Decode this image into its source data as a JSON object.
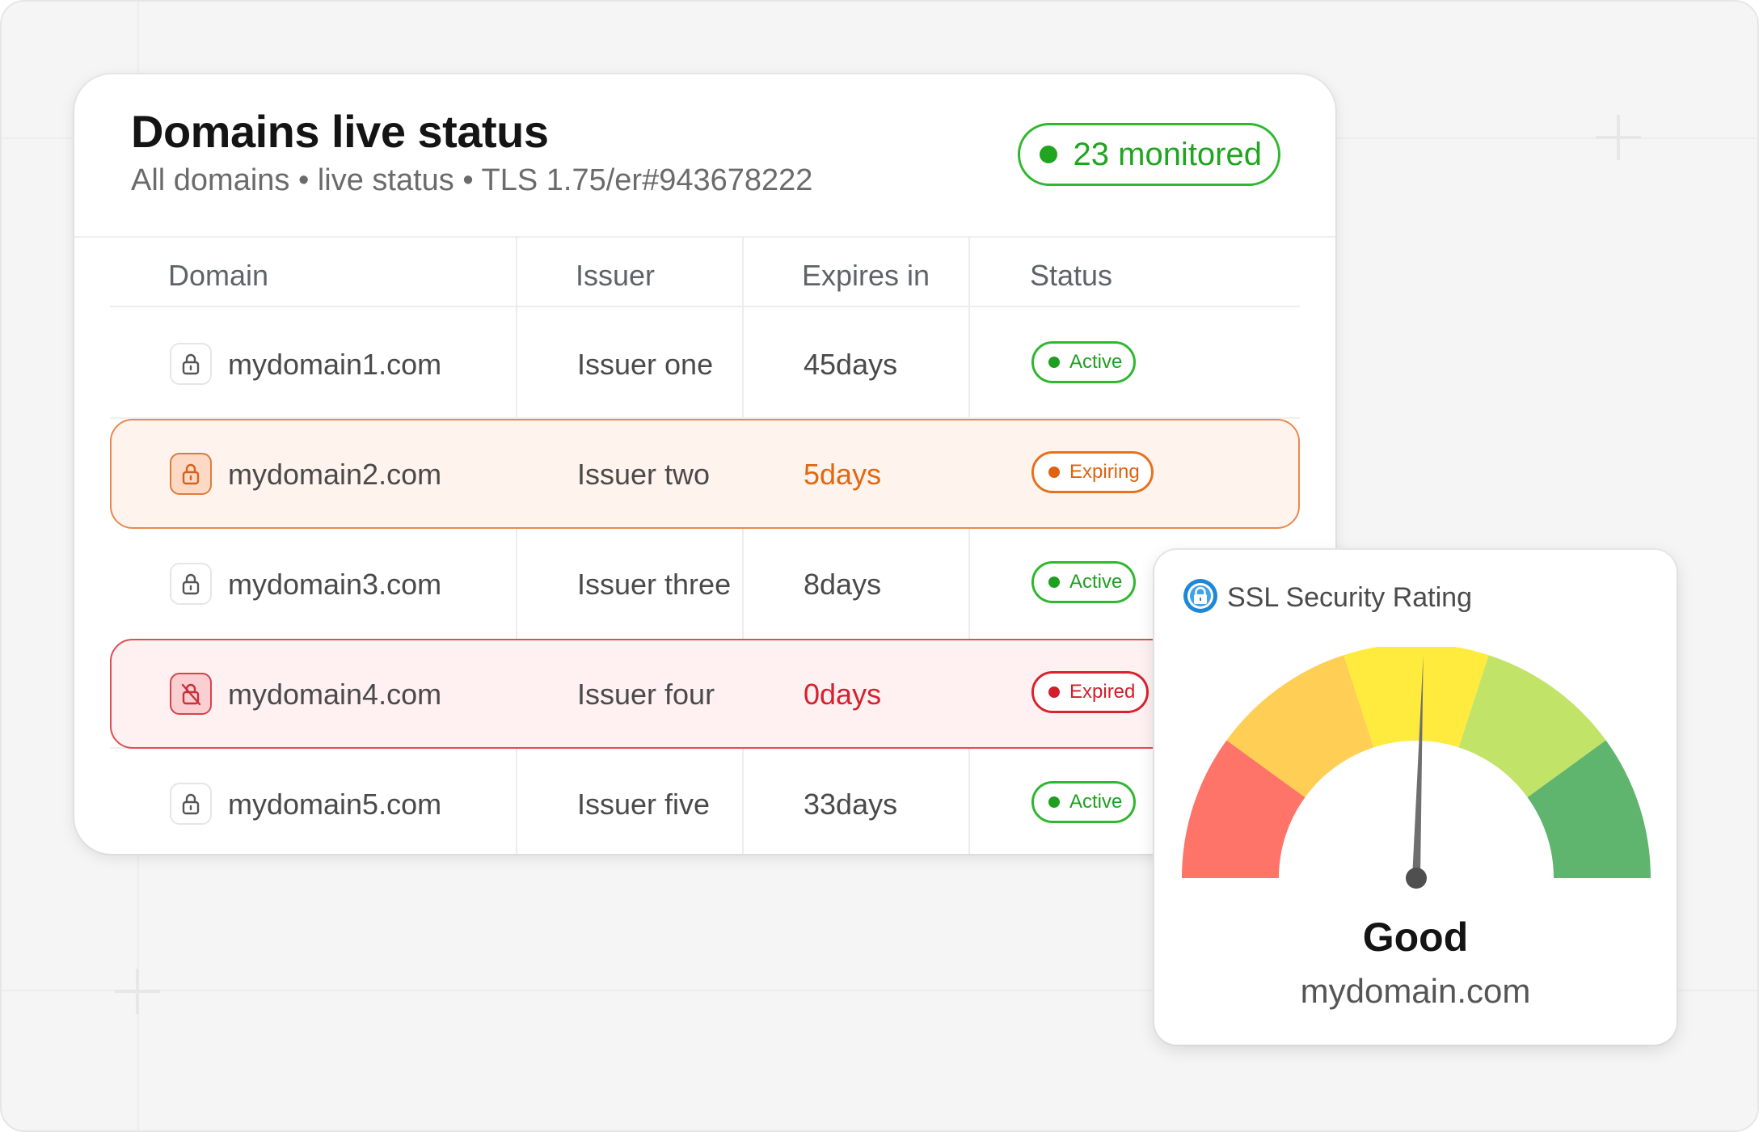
{
  "header": {
    "title": "Domains live status",
    "subtitle": "All domains • live status • TLS 1.75/er#943678222",
    "monitored_label": "23 monitored"
  },
  "table": {
    "columns": [
      "Domain",
      "Issuer",
      "Expires in",
      "Status"
    ],
    "rows": [
      {
        "domain": "mydomain1.com",
        "issuer": "Issuer one",
        "expires": "45days",
        "status": "Active",
        "state": "active"
      },
      {
        "domain": "mydomain2.com",
        "issuer": "Issuer two",
        "expires": "5days",
        "status": "Expiring",
        "state": "expiring"
      },
      {
        "domain": "mydomain3.com",
        "issuer": "Issuer three",
        "expires": "8days",
        "status": "Active",
        "state": "active"
      },
      {
        "domain": "mydomain4.com",
        "issuer": "Issuer four",
        "expires": "0days",
        "status": "Expired",
        "state": "expired"
      },
      {
        "domain": "mydomain5.com",
        "issuer": "Issuer five",
        "expires": "33days",
        "status": "Active",
        "state": "active"
      }
    ]
  },
  "gauge": {
    "title": "SSL Security Rating",
    "rating": "Good",
    "domain": "mydomain.com",
    "needle_fraction": 0.51,
    "segment_colors": [
      "#ff7468",
      "#ffcf55",
      "#ffeb3d",
      "#c1e468",
      "#5fb56e"
    ]
  },
  "colors": {
    "active": "#1f9f1f",
    "expiring": "#e0620c",
    "expired": "#d01f2b"
  },
  "icons": {
    "row_icon": "lock-icon",
    "expired_icon": "lock-off-icon",
    "gauge_icon": "shield-lock-icon"
  }
}
